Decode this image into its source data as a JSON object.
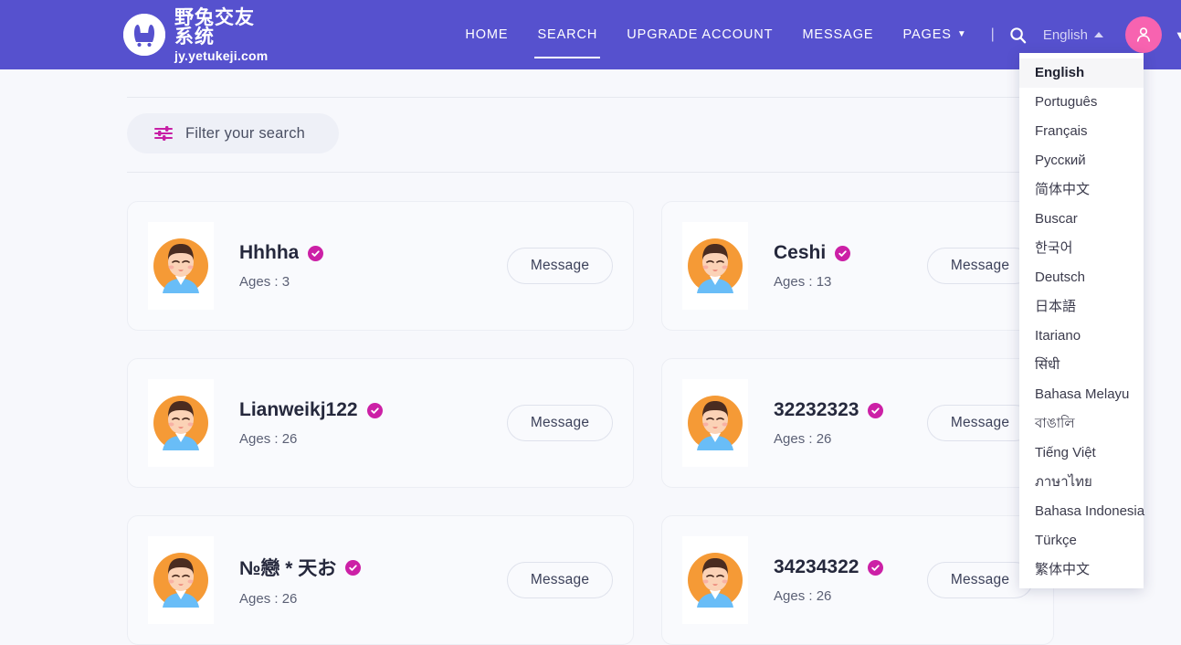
{
  "header": {
    "brand": {
      "logo_icon": "bunny-logo-icon",
      "cn_name": "野兔交友系统",
      "url": "jy.yetukeji.com"
    },
    "nav": [
      {
        "label": "HOME",
        "active": false,
        "caret": false
      },
      {
        "label": "SEARCH",
        "active": true,
        "caret": false
      },
      {
        "label": "UPGRADE ACCOUNT",
        "active": false,
        "caret": false
      },
      {
        "label": "MESSAGE",
        "active": false,
        "caret": false
      },
      {
        "label": "PAGES",
        "active": false,
        "caret": true
      }
    ],
    "separator": "|",
    "search_icon": "search-icon",
    "language_label": "English",
    "language_caret": "caret-up-icon",
    "avatar_icon": "user-avatar-icon",
    "avatar_caret": "chevron-down-icon",
    "brand_color": "#5651ce",
    "avatar_color": "#f763b0"
  },
  "language_menu": {
    "selected": "English",
    "items": [
      "English",
      "Português",
      "Français",
      "Русский",
      "简体中文",
      "Buscar",
      "한국어",
      "Deutsch",
      "日本語",
      "Itariano",
      "सिंधी",
      "Bahasa Melayu",
      "বাঙালি",
      "Tiếng Việt",
      "ภาษาไทย",
      "Bahasa Indonesia",
      "Türkçe",
      "繁体中文"
    ]
  },
  "filter": {
    "icon": "sliders-filter-icon",
    "label": "Filter your search",
    "icon_color": "#c71fa5"
  },
  "results": {
    "message_label": "Message",
    "verified_icon": "verified-check-icon",
    "avatar_icon": "profile-photo-icon",
    "cards": [
      {
        "name": "Hhhha",
        "age_label": "Ages : 3",
        "verified": true
      },
      {
        "name": "Ceshi",
        "age_label": "Ages : 13",
        "verified": true
      },
      {
        "name": "Lianweikj122",
        "age_label": "Ages : 26",
        "verified": true
      },
      {
        "name": "32232323",
        "age_label": "Ages : 26",
        "verified": true
      },
      {
        "name": "№戀 * 天お",
        "age_label": "Ages : 26",
        "verified": true
      },
      {
        "name": "34234322",
        "age_label": "Ages : 26",
        "verified": true
      }
    ]
  }
}
